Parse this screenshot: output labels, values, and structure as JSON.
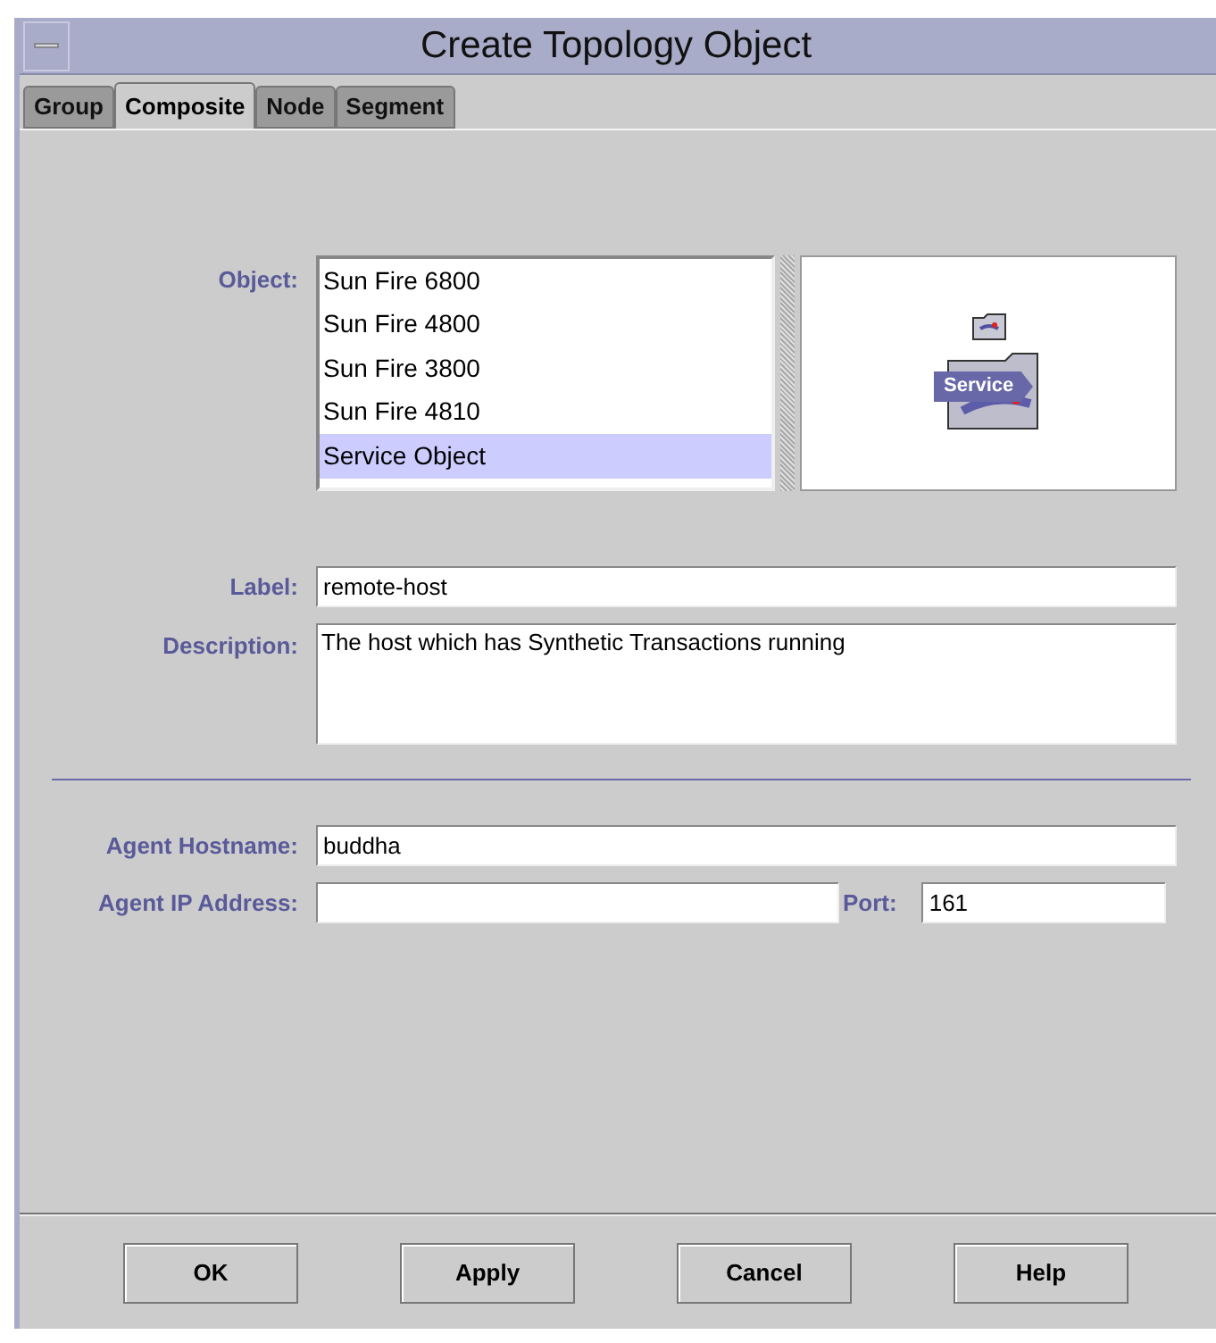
{
  "window": {
    "title": "Create Topology Object"
  },
  "tabs": [
    {
      "label": "Group",
      "selected": false
    },
    {
      "label": "Composite",
      "selected": true
    },
    {
      "label": "Node",
      "selected": false
    },
    {
      "label": "Segment",
      "selected": false
    }
  ],
  "object": {
    "label": "Object:",
    "items": [
      {
        "label": "Sun Fire 6800",
        "selected": false
      },
      {
        "label": "Sun Fire 4800",
        "selected": false
      },
      {
        "label": "Sun Fire 3800",
        "selected": false
      },
      {
        "label": "Sun Fire 4810",
        "selected": false
      },
      {
        "label": "Service Object",
        "selected": true
      }
    ],
    "preview": {
      "icon_label": "Service"
    }
  },
  "label_field": {
    "label": "Label:",
    "value": "remote-host"
  },
  "description": {
    "label": "Description:",
    "value": "The host which has Synthetic Transactions running"
  },
  "agent_hostname": {
    "label": "Agent Hostname:",
    "value": "buddha"
  },
  "agent_ip": {
    "label": "Agent IP Address:"
  },
  "port": {
    "label": "Port:",
    "value": "161"
  },
  "buttons": [
    "OK",
    "Apply",
    "Cancel",
    "Help"
  ]
}
